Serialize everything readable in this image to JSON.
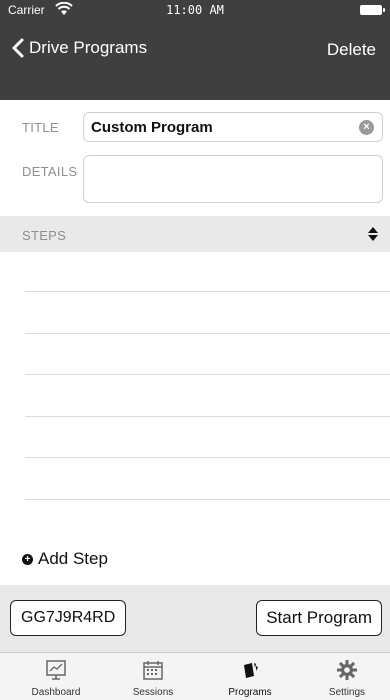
{
  "status_bar": {
    "carrier": "Carrier",
    "time": "11:00 AM"
  },
  "nav": {
    "back_label": "Drive Programs",
    "delete_label": "Delete"
  },
  "form": {
    "title_label": "TITLE",
    "title_value": "Custom Program",
    "details_label": "DETAILS",
    "details_value": ""
  },
  "steps": {
    "header_label": "STEPS",
    "items": [],
    "add_label": "Add Step"
  },
  "actions": {
    "code_label": "GG7J9R4RD",
    "start_label": "Start Program"
  },
  "tabbar": {
    "items": [
      {
        "label": "Dashboard",
        "icon": "dashboard-icon"
      },
      {
        "label": "Sessions",
        "icon": "calendar-icon"
      },
      {
        "label": "Programs",
        "icon": "programs-icon"
      },
      {
        "label": "Settings",
        "icon": "gear-icon"
      }
    ],
    "selected": "Programs"
  },
  "colors": {
    "nav_background": "#3f3f3f",
    "section_background": "#e9e9e9"
  }
}
